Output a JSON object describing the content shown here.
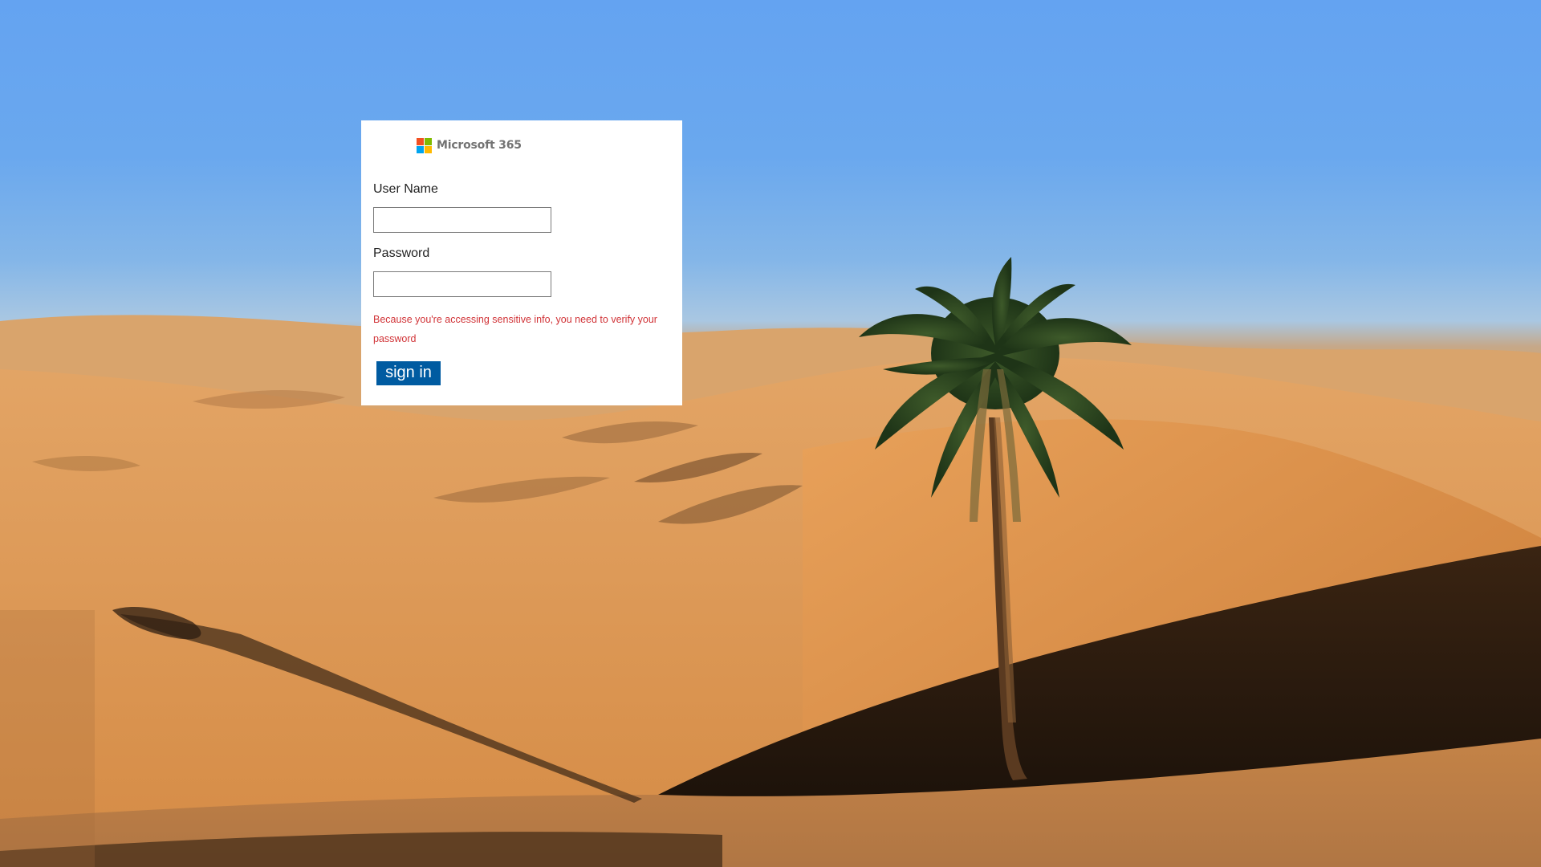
{
  "brand": {
    "logo_text": "Microsoft 365",
    "logo_icon": "microsoft-four-squares-logo",
    "logo_colors": [
      "#f25022",
      "#7fba00",
      "#00a4ef",
      "#ffb900"
    ]
  },
  "form": {
    "username_label": "User Name",
    "username_value": "",
    "password_label": "Password",
    "password_value": "",
    "warning_text": "Because you're accessing sensitive info, you need to verify your password",
    "submit_label": "sign in"
  },
  "colors": {
    "button_bg": "#005ba1",
    "warning_text": "#d13438",
    "card_bg": "#ffffff"
  },
  "background": {
    "scene": "desert-dunes-with-palm-tree"
  }
}
